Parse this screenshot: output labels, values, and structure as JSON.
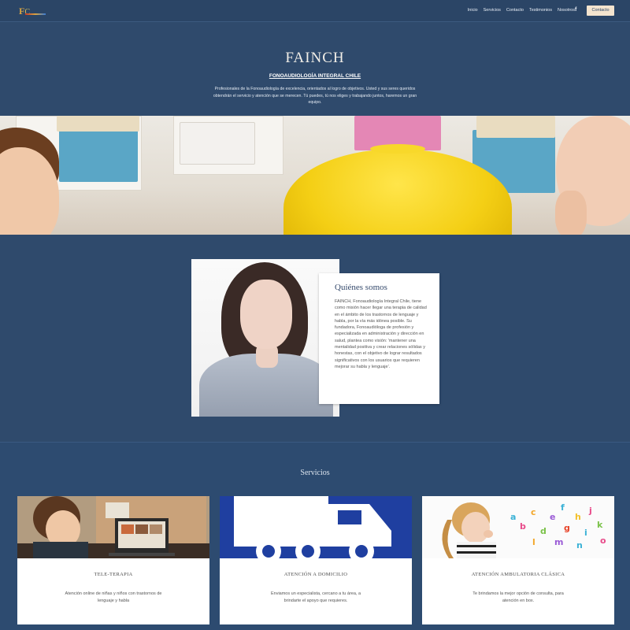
{
  "nav": {
    "logo_initial": "F",
    "logo_rest": "C",
    "links": [
      "Inicio",
      "Servicios",
      "Contacto",
      "Testimonios",
      "Nosotros"
    ],
    "social_icon": "facebook-icon",
    "social_glyph": "f",
    "cta_label": "Contacto"
  },
  "hero": {
    "title": "FAINCH",
    "subtitle": "FONOAUDIOLOGÍA INTEGRAL CHILE",
    "description": "Profesionales de la Fonoaudiología de excelencia, orientados al logro de objetivos. Usted y sus seres queridos obtendrán el servicio y atención que se merecen. Tú puedes, tú nos eliges y trabajando juntos, haremos un gran equipo."
  },
  "about": {
    "title": "Quiénes somos",
    "text": "FAINCH, Fonoaudiología Integral Chile, tiene como misión hacer llegar una terapia de calidad en el ámbito de los trastornos de lenguaje y habla, por la vía más idónea posible. Su fundadora, Fonoaudióloga de profesión y especializada en administración y dirección en salud, plantea como visión: 'mantener una mentalidad positiva y crear relaciones sólidas y honestas, con el objetivo de lograr resultados significativos con los usuarios que requieren mejorar su habla y lenguaje'."
  },
  "services": {
    "title": "Servicios",
    "items": [
      {
        "title": "TELE-TERAPIA",
        "text": "Atención online de niñas y niños con trastornos de lenguaje y habla"
      },
      {
        "title": "ATENCIÓN A DOMICILIO",
        "text": "Enviamos un especialista, cercano a tu área, a brindarte el apoyo que requieres."
      },
      {
        "title": "ATENCIÓN AMBULATORIA CLÁSICA",
        "text": "Te brindamos la mejor opción de consulta, para atención en box."
      }
    ]
  },
  "colors": {
    "page_bg": "#2f4a6c",
    "cta_bg": "#f4e4cf",
    "card_bg": "#ffffff",
    "truck_bg": "#1f3fa0"
  }
}
